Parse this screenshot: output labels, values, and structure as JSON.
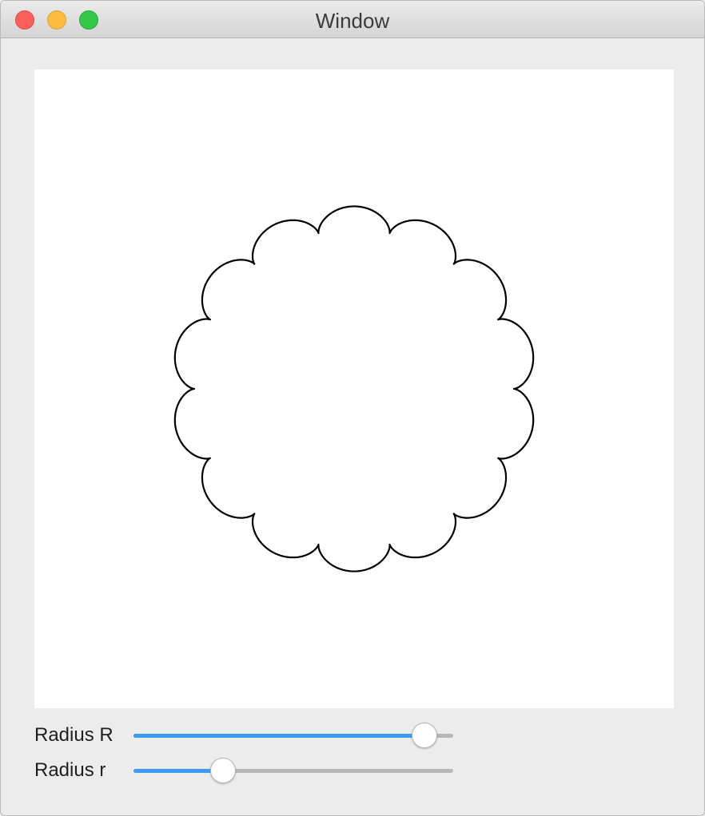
{
  "window": {
    "title": "Window"
  },
  "controls": {
    "slider_R": {
      "label": "Radius R",
      "fraction": 0.91
    },
    "slider_r": {
      "label": "Radius r",
      "fraction": 0.28
    }
  },
  "colors": {
    "accent": "#3d9bf5",
    "track": "#b7b7b7",
    "curve": "#000000",
    "canvas": "#ffffff"
  },
  "figure": {
    "type": "epicycloid",
    "lobes": 14
  }
}
